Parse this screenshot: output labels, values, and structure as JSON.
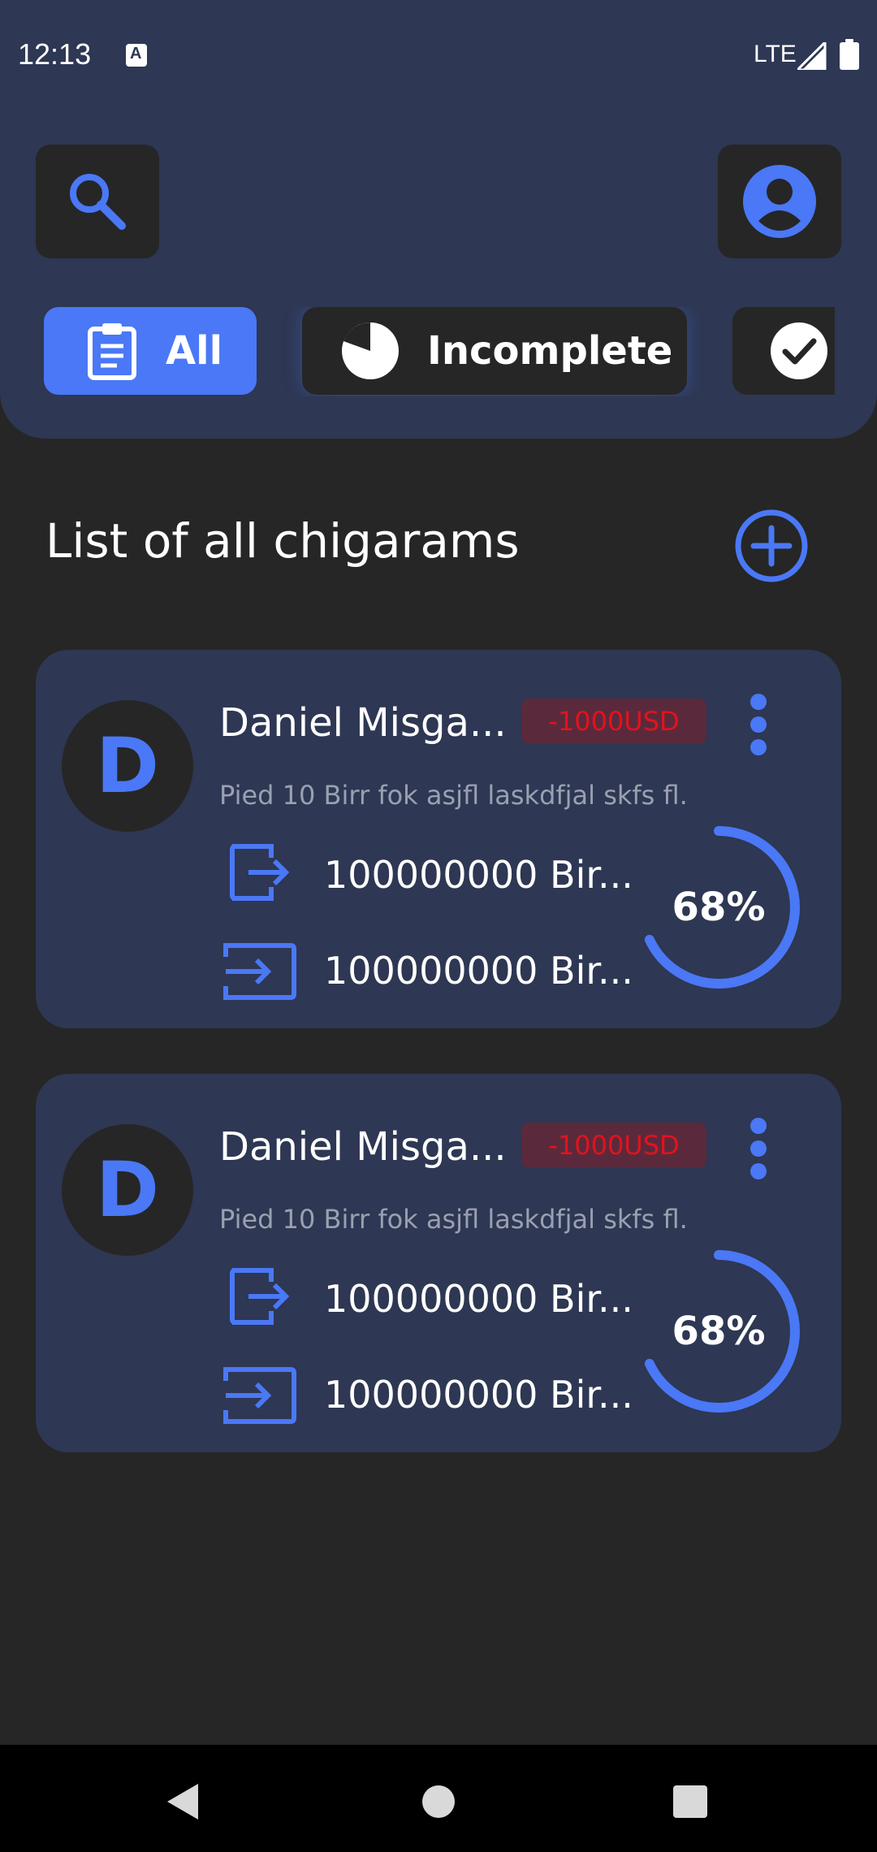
{
  "status_bar": {
    "time": "12:13",
    "network": "LTE"
  },
  "header": {
    "search_icon": "search-icon",
    "profile_icon": "account-circle-icon"
  },
  "filters": [
    {
      "label": "All",
      "icon": "clipboard-icon",
      "selected": true
    },
    {
      "label": "Incomplete",
      "icon": "pie-incomplete-icon",
      "selected": false
    },
    {
      "label": "",
      "icon": "check-circle-icon",
      "selected": false
    }
  ],
  "section": {
    "title": "List of all chigarams",
    "add_icon": "add-circle-icon"
  },
  "cards": [
    {
      "avatar_letter": "D",
      "name": "Daniel Misga...",
      "amount": "-1000USD",
      "description": "Pied 10 Birr fok asjfl laskdfjal skfs fl.",
      "out_value": "100000000 Bir...",
      "in_value": "100000000 Bir...",
      "progress_label": "68%",
      "progress": 0.68
    },
    {
      "avatar_letter": "D",
      "name": "Daniel Misga...",
      "amount": "-1000USD",
      "description": "Pied 10 Birr fok asjfl laskdfjal skfs fl.",
      "out_value": "100000000 Bir...",
      "in_value": "100000000 Bir...",
      "progress_label": "68%",
      "progress": 0.68
    }
  ],
  "colors": {
    "accent": "#4a78f6",
    "header_bg": "#2e3753",
    "page_bg": "#262626",
    "danger": "#e3121c"
  },
  "nav": [
    "back-icon",
    "home-icon",
    "recents-icon"
  ]
}
